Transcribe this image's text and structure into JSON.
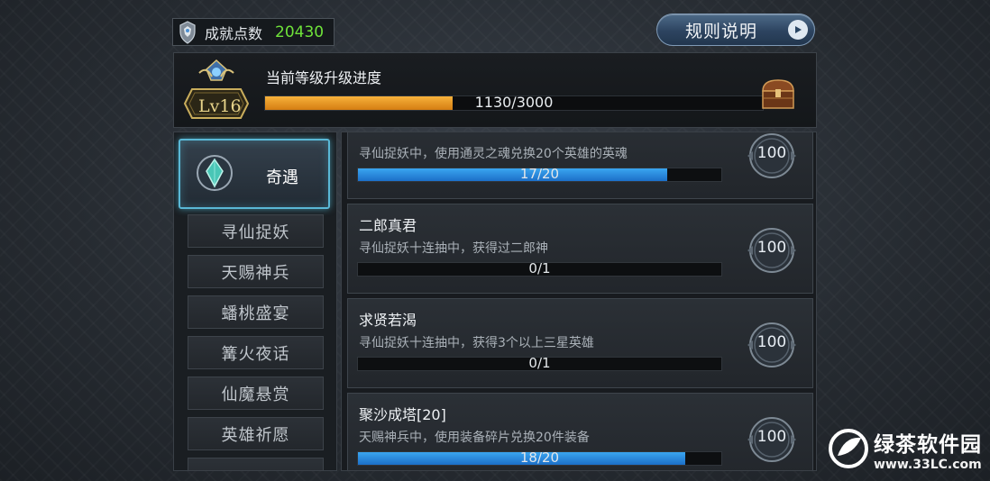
{
  "header": {
    "points_label": "成就点数",
    "points_value": "20430",
    "points_value_color": "#6fe33a",
    "rules_label": "规则说明"
  },
  "level": {
    "badge": "Lv16",
    "title": "当前等级升级进度",
    "progress_text": "1130/3000",
    "progress_fraction": 0.3767,
    "fill_color": "#f0a22e"
  },
  "sidebar": {
    "active": {
      "label": "奇遇",
      "icon": "jade-gem-icon"
    },
    "items": [
      {
        "label": "寻仙捉妖"
      },
      {
        "label": "天赐神兵"
      },
      {
        "label": "蟠桃盛宴"
      },
      {
        "label": "篝火夜话"
      },
      {
        "label": "仙魔悬赏"
      },
      {
        "label": "英雄祈愿"
      }
    ]
  },
  "achievements": [
    {
      "title": "",
      "desc": "寻仙捉妖中，使用通灵之魂兑换20个英雄的英魂",
      "progress_text": "17/20",
      "progress_fraction": 0.85,
      "reward": "100"
    },
    {
      "title": "二郎真君",
      "desc": "寻仙捉妖十连抽中，获得过二郎神",
      "progress_text": "0/1",
      "progress_fraction": 0,
      "reward": "100"
    },
    {
      "title": "求贤若渴",
      "desc": "寻仙捉妖十连抽中，获得3个以上三星英雄",
      "progress_text": "0/1",
      "progress_fraction": 0,
      "reward": "100"
    },
    {
      "title": "聚沙成塔[20]",
      "desc": "天赐神兵中，使用装备碎片兑换20件装备",
      "progress_text": "18/20",
      "progress_fraction": 0.9,
      "reward": "100"
    }
  ],
  "watermark": {
    "text": "绿茶软件园",
    "url": "www.33LC.com"
  }
}
